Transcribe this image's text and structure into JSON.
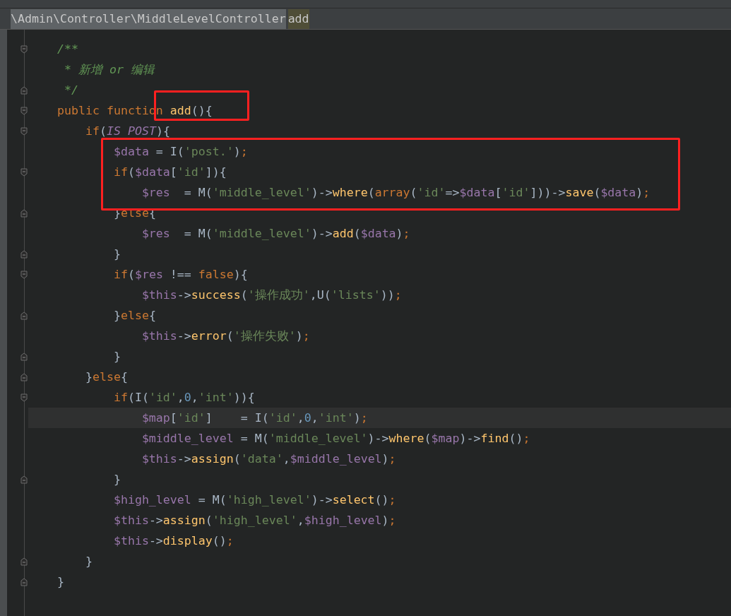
{
  "breadcrumb": {
    "path": "\\Admin\\Controller\\MiddleLevelController",
    "method": "add"
  },
  "lines": [
    {
      "kind": "start",
      "current": false,
      "tokens": [
        {
          "kind": "comment",
          "text": "/**"
        }
      ]
    },
    {
      "kind": "plain",
      "current": false,
      "tokens": [
        {
          "kind": "comment",
          "text": " * 新增 or 编辑"
        }
      ]
    },
    {
      "kind": "end",
      "current": false,
      "tokens": [
        {
          "kind": "comment",
          "text": " */"
        }
      ]
    },
    {
      "kind": "start",
      "current": false,
      "tokens": [
        {
          "kind": "kw",
          "text": "public function "
        },
        {
          "kind": "fn",
          "text": "add"
        },
        {
          "kind": "plain",
          "text": "(){"
        }
      ]
    },
    {
      "kind": "start",
      "current": false,
      "tokens": [
        {
          "kind": "kw",
          "text": "    if"
        },
        {
          "kind": "plain",
          "text": "("
        },
        {
          "kind": "const",
          "text": "IS POST"
        },
        {
          "kind": "plain",
          "text": "){"
        }
      ]
    },
    {
      "kind": "plain",
      "current": false,
      "tokens": [
        {
          "kind": "var",
          "text": "        $data"
        },
        {
          "kind": "plain",
          "text": " = I("
        },
        {
          "kind": "str",
          "text": "'post.'"
        },
        {
          "kind": "plain",
          "text": ")"
        },
        {
          "kind": "kw",
          "text": ";"
        }
      ]
    },
    {
      "kind": "start",
      "current": false,
      "tokens": [
        {
          "kind": "kw",
          "text": "        if"
        },
        {
          "kind": "plain",
          "text": "("
        },
        {
          "kind": "var",
          "text": "$data"
        },
        {
          "kind": "plain",
          "text": "["
        },
        {
          "kind": "str",
          "text": "'id'"
        },
        {
          "kind": "plain",
          "text": "]){"
        }
      ]
    },
    {
      "kind": "plain",
      "current": false,
      "tokens": [
        {
          "kind": "var",
          "text": "            $res"
        },
        {
          "kind": "plain",
          "text": "  = M("
        },
        {
          "kind": "str",
          "text": "'middle_level'"
        },
        {
          "kind": "plain",
          "text": ")->"
        },
        {
          "kind": "fn",
          "text": "where"
        },
        {
          "kind": "plain",
          "text": "("
        },
        {
          "kind": "kw",
          "text": "array"
        },
        {
          "kind": "plain",
          "text": "("
        },
        {
          "kind": "str",
          "text": "'id'"
        },
        {
          "kind": "plain",
          "text": "=>"
        },
        {
          "kind": "var",
          "text": "$data"
        },
        {
          "kind": "plain",
          "text": "["
        },
        {
          "kind": "str",
          "text": "'id'"
        },
        {
          "kind": "plain",
          "text": "]))->"
        },
        {
          "kind": "fn",
          "text": "save"
        },
        {
          "kind": "plain",
          "text": "("
        },
        {
          "kind": "var",
          "text": "$data"
        },
        {
          "kind": "plain",
          "text": ")"
        },
        {
          "kind": "kw",
          "text": ";"
        }
      ]
    },
    {
      "kind": "end",
      "current": false,
      "tokens": [
        {
          "kind": "plain",
          "text": "        }"
        },
        {
          "kind": "kw",
          "text": "else"
        },
        {
          "kind": "plain",
          "text": "{"
        }
      ]
    },
    {
      "kind": "plain",
      "current": false,
      "tokens": [
        {
          "kind": "var",
          "text": "            $res"
        },
        {
          "kind": "plain",
          "text": "  = M("
        },
        {
          "kind": "str",
          "text": "'middle_level'"
        },
        {
          "kind": "plain",
          "text": ")->"
        },
        {
          "kind": "fn",
          "text": "add"
        },
        {
          "kind": "plain",
          "text": "("
        },
        {
          "kind": "var",
          "text": "$data"
        },
        {
          "kind": "plain",
          "text": ")"
        },
        {
          "kind": "kw",
          "text": ";"
        }
      ]
    },
    {
      "kind": "end",
      "current": false,
      "tokens": [
        {
          "kind": "plain",
          "text": "        }"
        }
      ]
    },
    {
      "kind": "start",
      "current": false,
      "tokens": [
        {
          "kind": "kw",
          "text": "        if"
        },
        {
          "kind": "plain",
          "text": "("
        },
        {
          "kind": "var",
          "text": "$res"
        },
        {
          "kind": "plain",
          "text": " !== "
        },
        {
          "kind": "kw",
          "text": "false"
        },
        {
          "kind": "plain",
          "text": "){"
        }
      ]
    },
    {
      "kind": "plain",
      "current": false,
      "tokens": [
        {
          "kind": "var",
          "text": "            $this"
        },
        {
          "kind": "plain",
          "text": "->"
        },
        {
          "kind": "fn",
          "text": "success"
        },
        {
          "kind": "plain",
          "text": "("
        },
        {
          "kind": "str",
          "text": "'操作成功'"
        },
        {
          "kind": "plain",
          "text": ",U("
        },
        {
          "kind": "str",
          "text": "'lists'"
        },
        {
          "kind": "plain",
          "text": "))"
        },
        {
          "kind": "kw",
          "text": ";"
        }
      ]
    },
    {
      "kind": "end",
      "current": false,
      "tokens": [
        {
          "kind": "plain",
          "text": "        }"
        },
        {
          "kind": "kw",
          "text": "else"
        },
        {
          "kind": "plain",
          "text": "{"
        }
      ]
    },
    {
      "kind": "plain",
      "current": false,
      "tokens": [
        {
          "kind": "var",
          "text": "            $this"
        },
        {
          "kind": "plain",
          "text": "->"
        },
        {
          "kind": "fn",
          "text": "error"
        },
        {
          "kind": "plain",
          "text": "("
        },
        {
          "kind": "str",
          "text": "'操作失败'"
        },
        {
          "kind": "plain",
          "text": ")"
        },
        {
          "kind": "kw",
          "text": ";"
        }
      ]
    },
    {
      "kind": "end",
      "current": false,
      "tokens": [
        {
          "kind": "plain",
          "text": "        }"
        }
      ]
    },
    {
      "kind": "end",
      "current": false,
      "tokens": [
        {
          "kind": "plain",
          "text": "    }"
        },
        {
          "kind": "kw",
          "text": "else"
        },
        {
          "kind": "plain",
          "text": "{"
        }
      ]
    },
    {
      "kind": "start",
      "current": false,
      "tokens": [
        {
          "kind": "kw",
          "text": "        if"
        },
        {
          "kind": "plain",
          "text": "(I("
        },
        {
          "kind": "str",
          "text": "'id'"
        },
        {
          "kind": "plain",
          "text": ","
        },
        {
          "kind": "num",
          "text": "0"
        },
        {
          "kind": "plain",
          "text": ","
        },
        {
          "kind": "str",
          "text": "'int'"
        },
        {
          "kind": "plain",
          "text": ")){"
        }
      ]
    },
    {
      "kind": "plain",
      "current": true,
      "tokens": [
        {
          "kind": "var",
          "text": "            $map"
        },
        {
          "kind": "plain",
          "text": "["
        },
        {
          "kind": "str",
          "text": "'id'"
        },
        {
          "kind": "plain",
          "text": "]    = I("
        },
        {
          "kind": "str",
          "text": "'id'"
        },
        {
          "kind": "plain",
          "text": ","
        },
        {
          "kind": "num",
          "text": "0"
        },
        {
          "kind": "plain",
          "text": ","
        },
        {
          "kind": "str",
          "text": "'int'"
        },
        {
          "kind": "plain",
          "text": ")"
        },
        {
          "kind": "kw",
          "text": ";"
        }
      ]
    },
    {
      "kind": "plain",
      "current": false,
      "tokens": [
        {
          "kind": "var",
          "text": "            $middle_level"
        },
        {
          "kind": "plain",
          "text": " = M("
        },
        {
          "kind": "str",
          "text": "'middle_level'"
        },
        {
          "kind": "plain",
          "text": ")->"
        },
        {
          "kind": "fn",
          "text": "where"
        },
        {
          "kind": "plain",
          "text": "("
        },
        {
          "kind": "var",
          "text": "$map"
        },
        {
          "kind": "plain",
          "text": ")->"
        },
        {
          "kind": "fn",
          "text": "find"
        },
        {
          "kind": "plain",
          "text": "()"
        },
        {
          "kind": "kw",
          "text": ";"
        }
      ]
    },
    {
      "kind": "plain",
      "current": false,
      "tokens": [
        {
          "kind": "var",
          "text": "            $this"
        },
        {
          "kind": "plain",
          "text": "->"
        },
        {
          "kind": "fn",
          "text": "assign"
        },
        {
          "kind": "plain",
          "text": "("
        },
        {
          "kind": "str",
          "text": "'data'"
        },
        {
          "kind": "plain",
          "text": ","
        },
        {
          "kind": "var",
          "text": "$middle_level"
        },
        {
          "kind": "plain",
          "text": ")"
        },
        {
          "kind": "kw",
          "text": ";"
        }
      ]
    },
    {
      "kind": "end",
      "current": false,
      "tokens": [
        {
          "kind": "plain",
          "text": "        }"
        }
      ]
    },
    {
      "kind": "plain",
      "current": false,
      "tokens": [
        {
          "kind": "var",
          "text": "        $high_level"
        },
        {
          "kind": "plain",
          "text": " = M("
        },
        {
          "kind": "str",
          "text": "'high_level'"
        },
        {
          "kind": "plain",
          "text": ")->"
        },
        {
          "kind": "fn",
          "text": "select"
        },
        {
          "kind": "plain",
          "text": "()"
        },
        {
          "kind": "kw",
          "text": ";"
        }
      ]
    },
    {
      "kind": "plain",
      "current": false,
      "tokens": [
        {
          "kind": "var",
          "text": "        $this"
        },
        {
          "kind": "plain",
          "text": "->"
        },
        {
          "kind": "fn",
          "text": "assign"
        },
        {
          "kind": "plain",
          "text": "("
        },
        {
          "kind": "str",
          "text": "'high_level'"
        },
        {
          "kind": "plain",
          "text": ","
        },
        {
          "kind": "var",
          "text": "$high_level"
        },
        {
          "kind": "plain",
          "text": ")"
        },
        {
          "kind": "kw",
          "text": ";"
        }
      ]
    },
    {
      "kind": "plain",
      "current": false,
      "tokens": [
        {
          "kind": "var",
          "text": "        $this"
        },
        {
          "kind": "plain",
          "text": "->"
        },
        {
          "kind": "fn",
          "text": "display"
        },
        {
          "kind": "plain",
          "text": "()"
        },
        {
          "kind": "kw",
          "text": ";"
        }
      ]
    },
    {
      "kind": "end",
      "current": false,
      "tokens": [
        {
          "kind": "plain",
          "text": "    }"
        }
      ]
    },
    {
      "kind": "end",
      "current": false,
      "tokens": [
        {
          "kind": "plain",
          "text": "}"
        }
      ]
    }
  ]
}
